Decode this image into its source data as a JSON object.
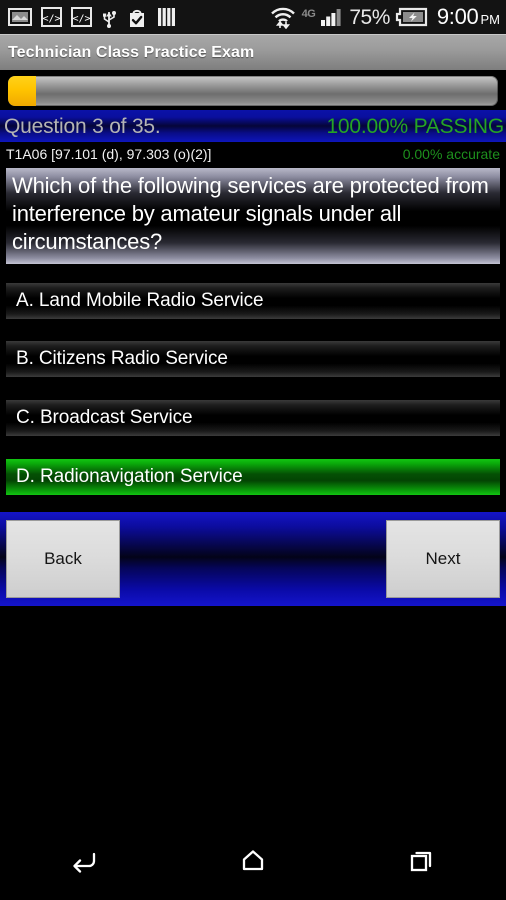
{
  "status_bar": {
    "icons": [
      "screenshot-icon",
      "code-icon",
      "code-icon",
      "usb-icon",
      "play-store-bag-icon",
      "barcode-icon"
    ],
    "wifi_icon": "wifi-transfer-icon",
    "network_type": "4G",
    "signal_icon": "cell-signal-icon",
    "battery_percent": "75%",
    "battery_icon": "battery-charging-icon",
    "time": "9:00",
    "am_pm": "PM"
  },
  "title_bar": {
    "title": "Technician Class Practice Exam"
  },
  "progress": {
    "percent": 5.7,
    "fill_color": "#ffc400",
    "track_color": "#8c8c8c"
  },
  "question_header": {
    "question_counter": "Question 3 of 35.",
    "passing": "100.00% PASSING",
    "passing_color": "#25a425",
    "band_color": "#0a0f9e"
  },
  "question_sub": {
    "code": "T1A06 [97.101 (d), 97.303 (o)(2)]",
    "accuracy": "0.00% accurate",
    "accuracy_color": "#1d8f1d"
  },
  "question": {
    "text": "Which of the following services are protected from interference by amateur signals under all circumstances?"
  },
  "options": [
    {
      "label": "A. Land Mobile Radio Service",
      "selected": false
    },
    {
      "label": "B. Citizens Radio Service",
      "selected": false
    },
    {
      "label": "C. Broadcast Service",
      "selected": false
    },
    {
      "label": "D. Radionavigation Service",
      "selected": true
    }
  ],
  "selected_color": "#0bab0b",
  "nav": {
    "back_label": "Back",
    "next_label": "Next",
    "bar_color": "#0c0c9c"
  },
  "system_nav": {
    "back": "back-icon",
    "home": "home-icon",
    "recents": "recents-icon"
  }
}
